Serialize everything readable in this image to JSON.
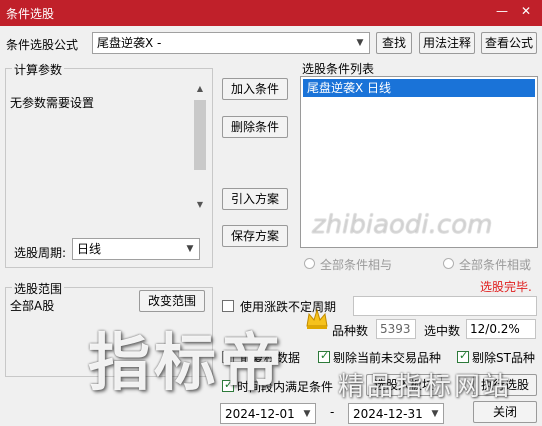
{
  "window": {
    "title": "条件选股",
    "minimize": "—",
    "close": "✕"
  },
  "formula": {
    "label": "条件选股公式",
    "value": "尾盘逆袭X  -",
    "find_btn": "查找",
    "usage_btn": "用法注释",
    "view_btn": "查看公式"
  },
  "params": {
    "group_label": "计算参数",
    "text": "无参数需要设置"
  },
  "actions": {
    "add": "加入条件",
    "remove": "删除条件",
    "import": "引入方案",
    "save": "保存方案"
  },
  "conditions": {
    "label": "选股条件列表",
    "items": [
      "尾盘逆袭X  日线"
    ]
  },
  "period": {
    "label": "选股周期:",
    "value": "日线"
  },
  "logic": {
    "and_label": "全部条件相与",
    "or_label": "全部条件相或"
  },
  "status": {
    "text": "选股完毕.",
    "color": "#e02020"
  },
  "range": {
    "group_label": "选股范围",
    "value": "全部A股",
    "change_btn": "改变范围"
  },
  "options": {
    "use_period_label": "使用涨跌不定周期",
    "count_label": "品种数",
    "count_value": "5393",
    "selected_label": "选中数",
    "selected_value": "12/0.2%",
    "prev_label": "前复权数据",
    "exclude_untraded_label": "剔除当前未交易品种",
    "exclude_st_label": "剔除ST品种",
    "time_label": "时间段内满足条件",
    "select_btn": "选股入板块",
    "execute_btn": "执行选股",
    "close_btn": "关闭"
  },
  "dates": {
    "start": "2024-12-01",
    "sep": "-",
    "end": "2024-12-31"
  },
  "watermark": {
    "main": "指标帝",
    "sub": "精品指标网站",
    "url": "zhibiaodi.com"
  }
}
